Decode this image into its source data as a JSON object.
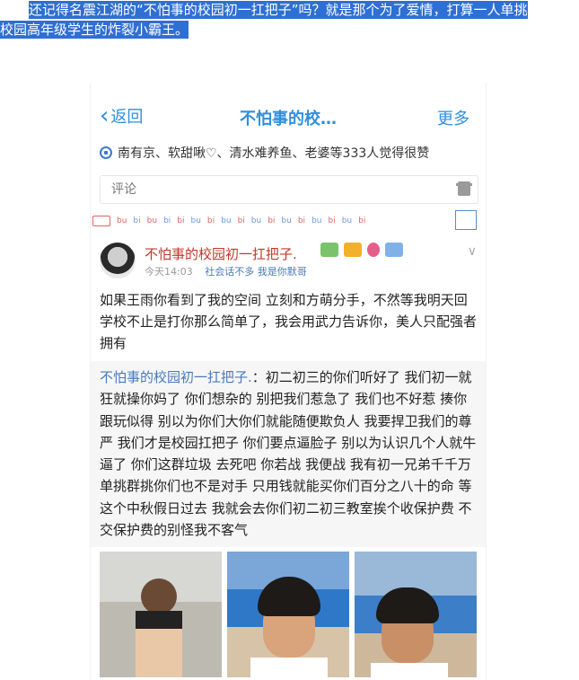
{
  "caption": {
    "line1": "还记得名震江湖的“不怕事的校园初一扛把子”吗？就是那个为了爱情，打算一人单挑",
    "line2": "校园高年级学生的炸裂小霸王。"
  },
  "colors": {
    "accent": "#2e8fe0",
    "highlight": "#2f6fd3",
    "author": "#c0392b"
  },
  "navbar": {
    "back_label": "返回",
    "title": "不怕事的校…",
    "more_label": "更多"
  },
  "likes": {
    "text": "南有京、软甜啾♡、清水难养鱼、老婆等333人觉得很赞",
    "icon": "heart-icon"
  },
  "comment": {
    "placeholder": "评论",
    "icon": "gift-icon"
  },
  "bubble_strip": [
    "bu",
    "bi",
    "bu",
    "bi",
    "bi",
    "bu",
    "bi",
    "bu",
    "bi",
    "bu",
    "bi",
    "bu",
    "bi",
    "bu",
    "bi",
    "bu",
    "bi"
  ],
  "post": {
    "author": "不怕事的校园初一扛把子.",
    "time": "今天14:03",
    "mood": "社会话不多 我是你默哥",
    "body": "如果王雨你看到了我的空间 立刻和方萌分手，不然等我明天回学校不止是打你那么简单了，我会用武力告诉你，美人只配强者拥有"
  },
  "quote": {
    "name": "不怕事的校园初一扛把子.",
    "text": "：初二初三的你们听好了 我们初一就狂就操你妈了 你们想杂的 别把我们惹急了 我们也不好惹 揍你跟玩似得 别以为你们大你们就能随便欺负人 我要捍卫我们的尊严 我们才是校园扛把子 你们要点逼脸子 别以为认识几个人就牛逼了 你们这群垃圾 去死吧 你若战 我便战 我有初一兄弟千千万 单挑群挑你们也不是对手 只用钱就能买你们百分之八十的命 等这个中秋假日过去 我就会去你们初二初三教室挨个收保护费 不交保护费的别怪我不客气"
  }
}
